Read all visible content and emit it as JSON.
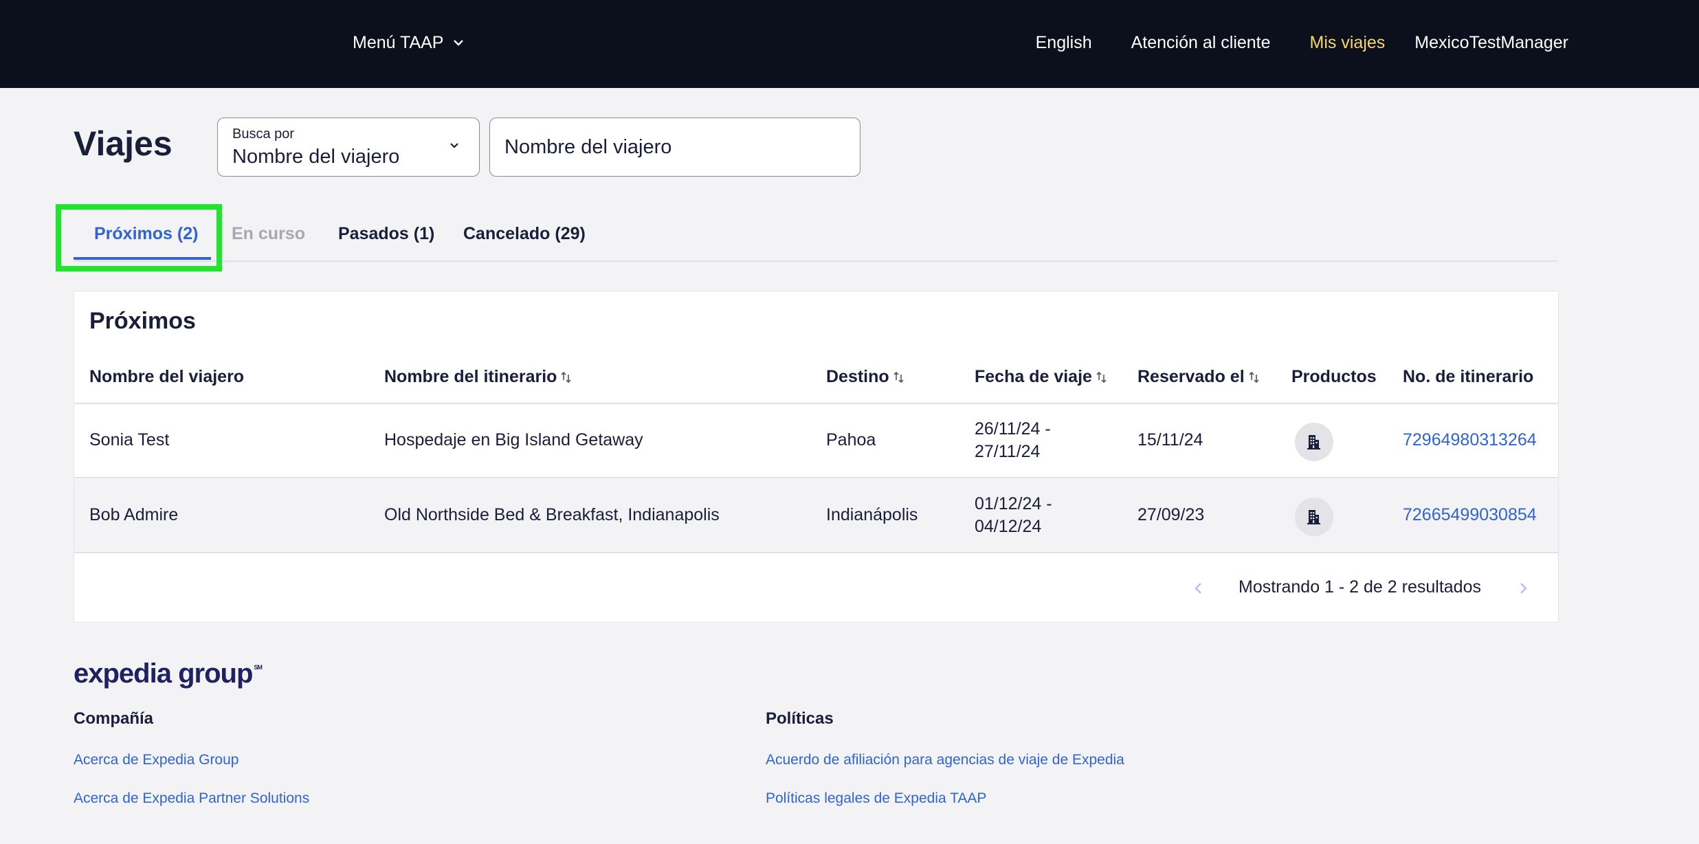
{
  "header": {
    "menu_label": "Menú TAAP",
    "language": "English",
    "support": "Atención al cliente",
    "my_trips": "Mis viajes",
    "user": "MexicoTestManager",
    "accent_color": "#f7d66a"
  },
  "page": {
    "title": "Viajes",
    "search_by": {
      "label": "Busca por",
      "selected": "Nombre del viajero"
    },
    "search_input": {
      "value": "",
      "placeholder": "Nombre del viajero"
    }
  },
  "tabs": [
    {
      "label": "Próximos (2)",
      "state": "active"
    },
    {
      "label": "En curso",
      "state": "disabled"
    },
    {
      "label": "Pasados (1)",
      "state": "normal"
    },
    {
      "label": "Cancelado (29)",
      "state": "normal"
    }
  ],
  "table": {
    "title": "Próximos",
    "columns": [
      {
        "label": "Nombre del viajero",
        "sortable": false
      },
      {
        "label": "Nombre del itinerario",
        "sortable": true
      },
      {
        "label": "Destino",
        "sortable": true
      },
      {
        "label": "Fecha de viaje",
        "sortable": true
      },
      {
        "label": "Reservado el",
        "sortable": true
      },
      {
        "label": "Productos",
        "sortable": false
      },
      {
        "label": "No. de itinerario",
        "sortable": false
      }
    ],
    "rows": [
      {
        "traveler": "Sonia Test",
        "itinerary_name": "Hospedaje en Big Island Getaway",
        "destination": "Pahoa",
        "travel_date_start": "26/11/24 -",
        "travel_date_end": "27/11/24",
        "booked_on": "15/11/24",
        "product_icon": "hotel-building-icon",
        "itinerary_number": "72964980313264"
      },
      {
        "traveler": "Bob Admire",
        "itinerary_name": "Old Northside Bed & Breakfast, Indianapolis",
        "destination": "Indianápolis",
        "travel_date_start": "01/12/24 -",
        "travel_date_end": "04/12/24",
        "booked_on": "27/09/23",
        "product_icon": "hotel-building-icon",
        "itinerary_number": "72665499030854"
      }
    ],
    "pagination": {
      "status": "Mostrando 1 - 2 de 2 resultados",
      "prev_icon": "chevron-left-icon",
      "next_icon": "chevron-right-icon"
    }
  },
  "footer": {
    "logo": "expedia group",
    "logo_mark": "SM",
    "columns": [
      {
        "heading": "Compañía",
        "links": [
          "Acerca de Expedia Group",
          "Acerca de Expedia Partner Solutions"
        ]
      },
      {
        "heading": "Políticas",
        "links": [
          "Acuerdo de afiliación para agencias de viaje de Expedia",
          "Políticas legales de Expedia TAAP"
        ]
      }
    ]
  },
  "colors": {
    "link": "#2f64d2",
    "nav_bg": "#0c0f1c",
    "highlight": "#1ee62a"
  }
}
